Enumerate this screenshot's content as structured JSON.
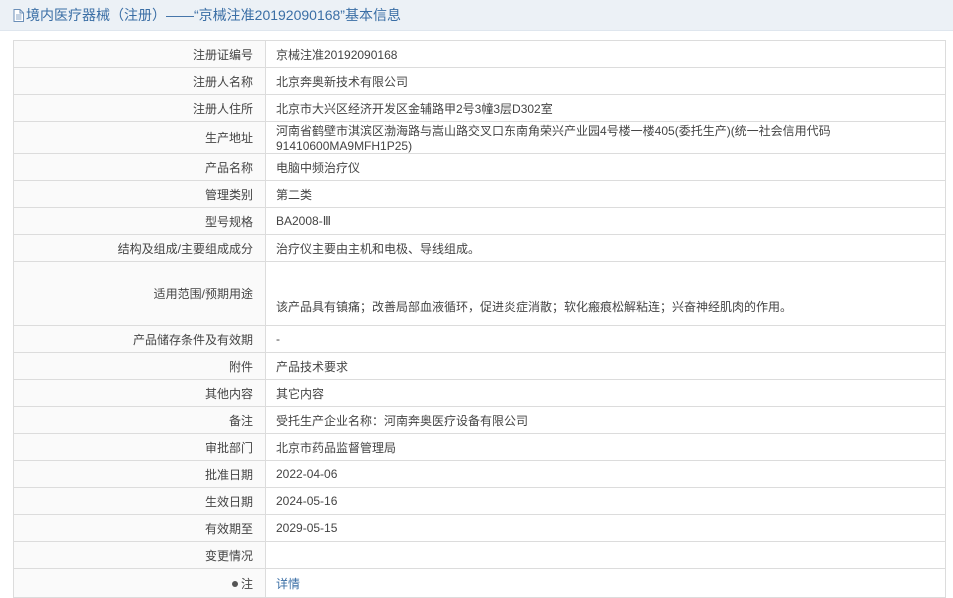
{
  "header": {
    "title": "境内医疗器械（注册）——“京械注准20192090168”基本信息",
    "icon": "document-icon"
  },
  "rows": [
    {
      "label": "注册证编号",
      "value": "京械注准20192090168"
    },
    {
      "label": "注册人名称",
      "value": "北京奔奥新技术有限公司"
    },
    {
      "label": "注册人住所",
      "value": "北京市大兴区经济开发区金辅路甲2号3幢3层D302室"
    },
    {
      "label": "生产地址",
      "value": "河南省鹤壁市淇滨区渤海路与嵩山路交叉口东南角荣兴产业园4号楼一楼405(委托生产)(统一社会信用代码91410600MA9MFH1P25)"
    },
    {
      "label": "产品名称",
      "value": "电脑中频治疗仪"
    },
    {
      "label": "管理类别",
      "value": "第二类"
    },
    {
      "label": "型号规格",
      "value": "BA2008-Ⅲ"
    },
    {
      "label": "结构及组成/主要组成成分",
      "value": "治疗仪主要由主机和电极、导线组成。"
    },
    {
      "label": "适用范围/预期用途",
      "value": "该产品具有镇痛；改善局部血液循环，促进炎症消散；软化瘢痕松解粘连；兴奋神经肌肉的作用。"
    },
    {
      "label": "产品储存条件及有效期",
      "value": "-"
    },
    {
      "label": "附件",
      "value": "产品技术要求"
    },
    {
      "label": "其他内容",
      "value": "其它内容"
    },
    {
      "label": "备注",
      "value": "受托生产企业名称：河南奔奥医疗设备有限公司"
    },
    {
      "label": "审批部门",
      "value": "北京市药品监督管理局"
    },
    {
      "label": "批准日期",
      "value": "2022-04-06"
    },
    {
      "label": "生效日期",
      "value": "2024-05-16"
    },
    {
      "label": "有效期至",
      "value": "2029-05-15"
    },
    {
      "label": "变更情况",
      "value": ""
    },
    {
      "label": "注",
      "value": "详情"
    }
  ],
  "colors": {
    "header_bg": "#ecf1f6",
    "title": "#3a6ea5",
    "link": "#3a6ea5"
  }
}
